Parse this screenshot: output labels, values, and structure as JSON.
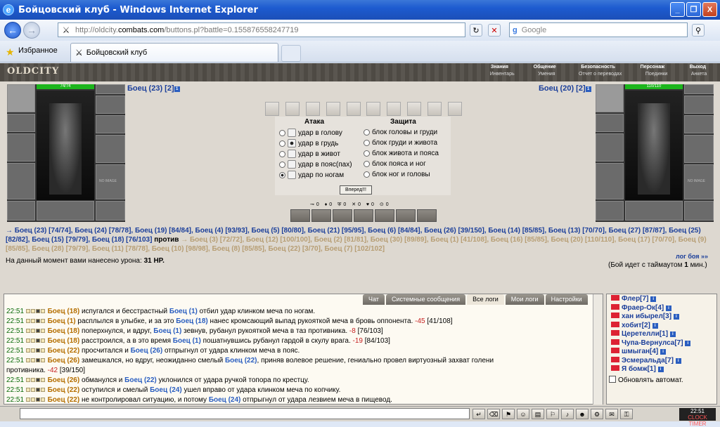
{
  "window": {
    "title": "Бойцовский клуб - Windows Internet Explorer",
    "min": "_",
    "max": "❐",
    "close": "X"
  },
  "nav": {
    "back": "←",
    "forward": "→",
    "url_prefix": "http://oldcity.",
    "url_domain": "combats.com",
    "url_rest": "/buttons.pl?battle=0.155876558247719",
    "search_label": "Google",
    "search_engine": "g",
    "search_btn": "⚲"
  },
  "favbar": {
    "favorites": "Избранное",
    "tab_title": "Бойцовский клуб"
  },
  "game": {
    "logo": "OLDCITY",
    "menu_top": [
      "Знания",
      "Общение",
      "Безопасность",
      "Персонаж",
      "Выход"
    ],
    "menu_bottom": [
      "Инвентарь",
      "Умения",
      "Отчет о переводах",
      "Поединки",
      "Анкета"
    ],
    "left_player": {
      "name": "Боец (23) [2]",
      "hp": "74/74",
      "level": "1"
    },
    "right_player": {
      "name": "Боец (20) [2]",
      "hp": "110/110",
      "level": "1"
    },
    "no_image": "NO IMAGE",
    "attack_header": "Атака",
    "defense_header": "Защита",
    "attacks": [
      "удар в голову",
      "удар в грудь",
      "удар в живот",
      "удар в пояс(пах)",
      "удар по ногам"
    ],
    "defenses": [
      "блок головы и груди",
      "блок груди и живота",
      "блок живота и пояса",
      "блок пояса и ног",
      "блок ног и головы"
    ],
    "go_button": "Вперед!!!",
    "counters": "⊸0 ♦0 ⛨0 ✕0 ♥0 ⊙0",
    "team_left_text": "→ Боец (23) [74/74], Боец (24) [78/78], Боец (19) [84/84], Боец (4) [93/93], Боец (5) [80/80], Боец (21) [95/95], Боец (6) [84/84], Боец (26) [39/150], Боец (14) [85/85], Боец (13) [70/70], Боец (27) [87/87], Боец (25) [82/82], Боец (15) [79/79], Боец (18) [76/103]",
    "versus": "против",
    "team_right_text": "→ Боец (3) [72/72], Боец (12) [100/100], Боец (2) [81/81], Боец (30) [89/89], Боец (1) [41/108], Боец (16) [85/85], Боец (20) [110/110], Боец (17) [70/70], Боец (9) [85/85], Боец (28) [79/79], Боец (11) [78/78], Боец (10) [98/98], Боец (8) [85/85], Боец (22) [3/70], Боец (7) [102/102]",
    "damage_prefix": "На данный момент вами нанесено урона:",
    "damage_value": "31 HP.",
    "log_link": "лог боя »»",
    "timeout_prefix": "(Бой идет с таймаутом",
    "timeout_value": "1",
    "timeout_suffix": "мин.)"
  },
  "chat": {
    "tabs": [
      "Чат",
      "Системные сообщения",
      "Все логи",
      "Мои логи",
      "Настройки"
    ],
    "messages": [
      {
        "time": "22:51",
        "a": "Боец (18)",
        "t1": " испугался и бесстрастный ",
        "b": "Боец (1)",
        "t2": " отбил удар клинком меча по ногам.",
        "dmg": "",
        "hp": ""
      },
      {
        "time": "22:51",
        "a": "Боец (1)",
        "t1": " расплылся в улыбке, и за это ",
        "b": "Боец (18)",
        "t2": " нанес кромсающий выпад рукояткой меча в бровь оппонента.",
        "dmg": "-45",
        "hp": "[41/108]"
      },
      {
        "time": "22:51",
        "a": "Боец (18)",
        "t1": " поперхнулся, и вдруг, ",
        "b": "Боец (1)",
        "t2": " зевнув, рубанул рукояткой меча в таз противника.",
        "dmg": "-8",
        "hp": "[76/103]"
      },
      {
        "time": "22:51",
        "a": "Боец (18)",
        "t1": " расстроился, а в это время ",
        "b": "Боец (1)",
        "t2": " пошатнувшись рубанул гардой в скулу врага.",
        "dmg": "-19",
        "hp": "[84/103]"
      },
      {
        "time": "22:51",
        "a": "Боец (22)",
        "t1": " просчитался и ",
        "b": "Боец (26)",
        "t2": " отпрыгнул от удара клинком меча в пояс.",
        "dmg": "",
        "hp": ""
      },
      {
        "time": "22:51",
        "a": "Боец (26)",
        "t1": " замешкался, но вдруг, неожиданно смелый ",
        "b": "Боец (22)",
        "t2": ", приняв волевое решение, гениально провел виртуозный захват голени",
        "dmg": "",
        "hp": ""
      },
      {
        "time": "",
        "a": "",
        "t1": "противника.",
        "b": "",
        "t2": "",
        "dmg": "-42",
        "hp": "[39/150]"
      },
      {
        "time": "22:51",
        "a": "Боец (26)",
        "t1": " обманулся и ",
        "b": "Боец (22)",
        "t2": " уклонился от удара ручкой топора по крестцу.",
        "dmg": "",
        "hp": ""
      },
      {
        "time": "22:51",
        "a": "Боец (22)",
        "t1": " оступился и смелый ",
        "b": "Боец (24)",
        "t2": " ушел вправо от удара клинком меча по копчику.",
        "dmg": "",
        "hp": ""
      },
      {
        "time": "22:51",
        "a": "Боец (22)",
        "t1": " не контролировал ситуацию, и потому ",
        "b": "Боец (24)",
        "t2": " отпрыгнул от удара лезвием меча в пищевод.",
        "dmg": "",
        "hp": ""
      }
    ]
  },
  "players_list": [
    "Флер[7]",
    "Фраер-Ок[4]",
    "хан ибырел[3]",
    "хобит[2]",
    "Церетелли[1]",
    "Чупа-Вернулса[7]",
    "шмыган[4]",
    "Эсмеральда[7]",
    "Я бомж[1]"
  ],
  "auto_update": "Обновлять автомат.",
  "clock": {
    "time": "22:51",
    "label": "CLOCK TIMER"
  }
}
